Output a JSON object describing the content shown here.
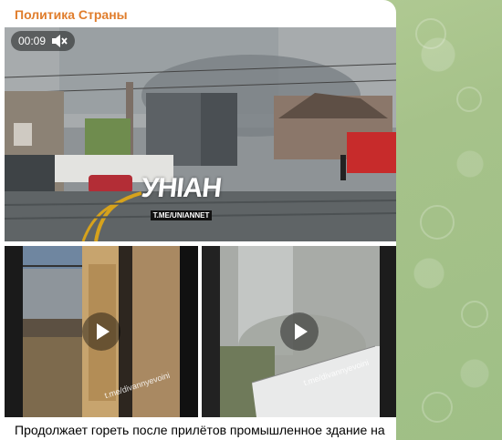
{
  "channel": {
    "name": "Политика Страны"
  },
  "main_video": {
    "duration": "00:09",
    "mute_icon": "volume-mute-icon",
    "watermark_logo": "УНІАН",
    "watermark_url": "T.ME/UNIANNET"
  },
  "thumbnails": [
    {
      "watermark": "t.me/divannyevoini",
      "play_icon": "play-icon"
    },
    {
      "watermark": "t.me/divannyevoini",
      "play_icon": "play-icon"
    }
  ],
  "message": {
    "text": "Продолжает гореть после прилётов промышленное здание на"
  },
  "colors": {
    "channel_name": "#e07d2c",
    "chat_background": "#a9c690",
    "bubble": "#ffffff"
  }
}
